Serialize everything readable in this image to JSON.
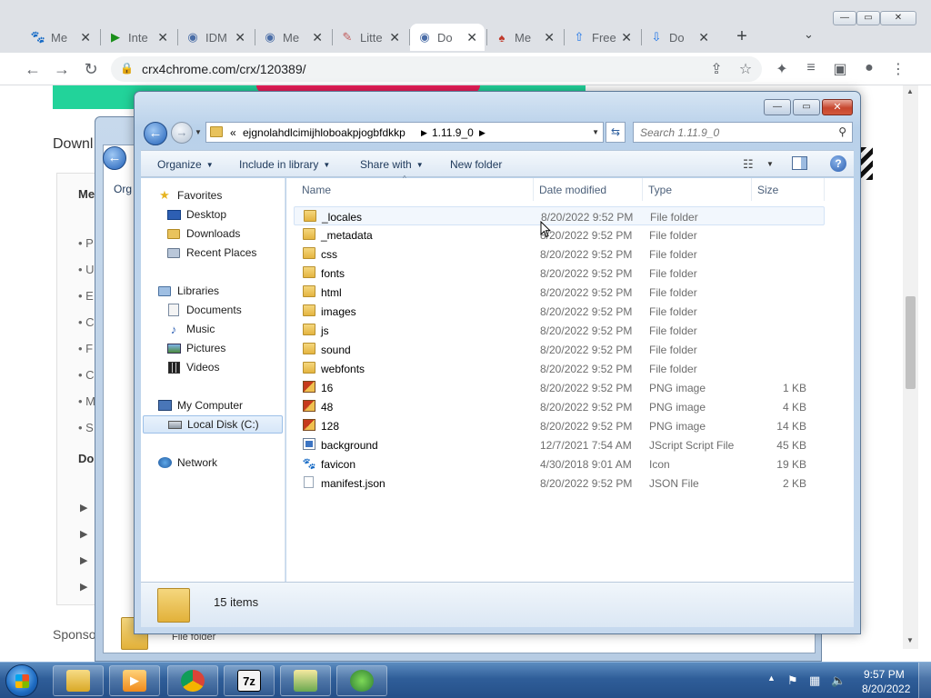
{
  "browser": {
    "tabs": [
      {
        "label": "Me",
        "icon": "paw-icon",
        "active": false
      },
      {
        "label": "Inte",
        "icon": "play-icon",
        "active": false
      },
      {
        "label": "IDM",
        "icon": "globe-icon",
        "active": false
      },
      {
        "label": "Me",
        "icon": "globe-icon",
        "active": false
      },
      {
        "label": "Litte",
        "icon": "paper-icon",
        "active": false
      },
      {
        "label": "Do",
        "icon": "globe-icon",
        "active": true
      },
      {
        "label": "Me",
        "icon": "hat-icon",
        "active": false
      },
      {
        "label": "Free",
        "icon": "upload-icon",
        "active": false
      },
      {
        "label": "Do",
        "icon": "download-icon",
        "active": false
      }
    ],
    "url": "crx4chrome.com/crx/120389/"
  },
  "webpage": {
    "heading": "Downl",
    "side_lines": [
      "• P",
      "• U",
      "• E",
      "• C",
      "• F",
      "• C",
      "• M",
      "• S"
    ],
    "side_bold_top": "Me",
    "side_bold_bottom": "Do",
    "sponsored": "Sponso"
  },
  "back_window": {
    "organize_fragment": "Org",
    "status_text": "File folder"
  },
  "explorer": {
    "breadcrumb": {
      "chevrons": "«",
      "parent": "ejgnolahdlcimijhloboakpjogbfdkkp",
      "current": "1.11.9_0"
    },
    "search_placeholder": "Search 1.11.9_0",
    "commands": {
      "organize": "Organize",
      "include_in_library": "Include in library",
      "share_with": "Share with",
      "new_folder": "New folder"
    },
    "nav": {
      "favorites": "Favorites",
      "desktop": "Desktop",
      "downloads": "Downloads",
      "recent_places": "Recent Places",
      "libraries": "Libraries",
      "documents": "Documents",
      "music": "Music",
      "pictures": "Pictures",
      "videos": "Videos",
      "my_computer": "My Computer",
      "local_disk": "Local Disk (C:)",
      "network": "Network"
    },
    "columns": {
      "name": "Name",
      "date": "Date modified",
      "type": "Type",
      "size": "Size"
    },
    "files": [
      {
        "name": "_locales",
        "date": "8/20/2022 9:52 PM",
        "type": "File folder",
        "size": "",
        "icon": "folder"
      },
      {
        "name": "_metadata",
        "date": "8/20/2022 9:52 PM",
        "type": "File folder",
        "size": "",
        "icon": "folder"
      },
      {
        "name": "css",
        "date": "8/20/2022 9:52 PM",
        "type": "File folder",
        "size": "",
        "icon": "folder"
      },
      {
        "name": "fonts",
        "date": "8/20/2022 9:52 PM",
        "type": "File folder",
        "size": "",
        "icon": "folder"
      },
      {
        "name": "html",
        "date": "8/20/2022 9:52 PM",
        "type": "File folder",
        "size": "",
        "icon": "folder"
      },
      {
        "name": "images",
        "date": "8/20/2022 9:52 PM",
        "type": "File folder",
        "size": "",
        "icon": "folder"
      },
      {
        "name": "js",
        "date": "8/20/2022 9:52 PM",
        "type": "File folder",
        "size": "",
        "icon": "folder"
      },
      {
        "name": "sound",
        "date": "8/20/2022 9:52 PM",
        "type": "File folder",
        "size": "",
        "icon": "folder"
      },
      {
        "name": "webfonts",
        "date": "8/20/2022 9:52 PM",
        "type": "File folder",
        "size": "",
        "icon": "folder"
      },
      {
        "name": "16",
        "date": "8/20/2022 9:52 PM",
        "type": "PNG image",
        "size": "1 KB",
        "icon": "png"
      },
      {
        "name": "48",
        "date": "8/20/2022 9:52 PM",
        "type": "PNG image",
        "size": "4 KB",
        "icon": "png"
      },
      {
        "name": "128",
        "date": "8/20/2022 9:52 PM",
        "type": "PNG image",
        "size": "14 KB",
        "icon": "png"
      },
      {
        "name": "background",
        "date": "12/7/2021 7:54 AM",
        "type": "JScript Script File",
        "size": "45 KB",
        "icon": "js"
      },
      {
        "name": "favicon",
        "date": "4/30/2018 9:01 AM",
        "type": "Icon",
        "size": "19 KB",
        "icon": "ico"
      },
      {
        "name": "manifest.json",
        "date": "8/20/2022 9:52 PM",
        "type": "JSON File",
        "size": "2 KB",
        "icon": "json"
      }
    ],
    "item_count": "15 items"
  },
  "taskbar": {
    "apps": [
      {
        "name": "explorer",
        "label": ""
      },
      {
        "name": "media-player",
        "label": "▶"
      },
      {
        "name": "chrome",
        "label": ""
      },
      {
        "name": "7zip",
        "label": "7z"
      },
      {
        "name": "installer",
        "label": ""
      },
      {
        "name": "idm",
        "label": ""
      }
    ],
    "time": "9:57 PM",
    "date": "8/20/2022"
  }
}
